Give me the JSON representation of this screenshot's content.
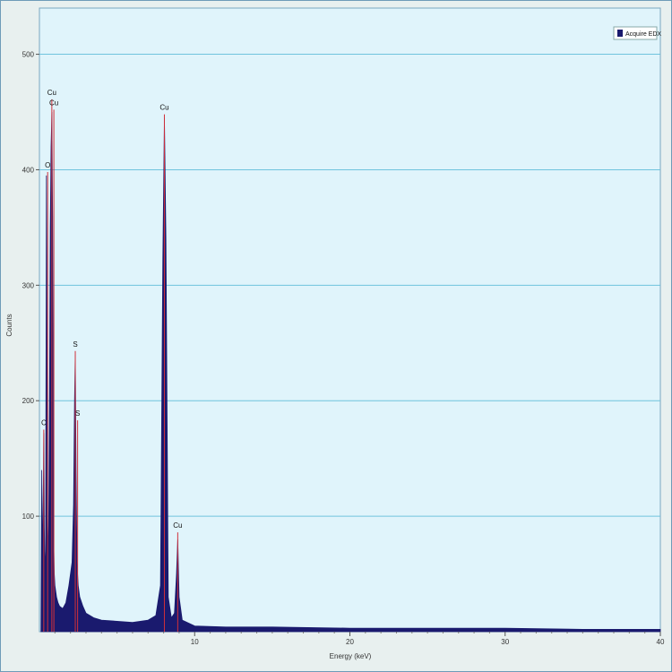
{
  "chart_data": {
    "type": "line",
    "xlabel": "Energy (keV)",
    "ylabel": "Counts",
    "xlim": [
      0,
      40
    ],
    "ylim": [
      0,
      500
    ],
    "xticks": [
      10,
      20,
      30,
      40
    ],
    "yticks": [
      100,
      200,
      300,
      400,
      500
    ],
    "grid": "horizontal",
    "legend": {
      "position": "top-right",
      "entries": [
        "Acquire EDX"
      ]
    },
    "series": [
      {
        "name": "Acquire EDX",
        "color": "#1a1a6e",
        "x": [
          0.1,
          0.15,
          0.2,
          0.25,
          0.28,
          0.32,
          0.36,
          0.4,
          0.45,
          0.5,
          0.52,
          0.55,
          0.6,
          0.65,
          0.7,
          0.75,
          0.8,
          0.85,
          0.9,
          0.93,
          0.96,
          1.0,
          1.05,
          1.1,
          1.2,
          1.3,
          1.5,
          1.7,
          1.9,
          2.1,
          2.2,
          2.26,
          2.31,
          2.36,
          2.42,
          2.5,
          2.6,
          2.8,
          3.0,
          3.5,
          4.0,
          5.0,
          6.0,
          7.0,
          7.5,
          7.8,
          7.95,
          8.05,
          8.15,
          8.3,
          8.5,
          8.7,
          8.83,
          8.91,
          9.0,
          9.2,
          10.0,
          12.0,
          15.0,
          20.0,
          25.0,
          30.0,
          35.0,
          40.0
        ],
        "y": [
          0,
          140,
          60,
          120,
          172,
          90,
          50,
          70,
          395,
          180,
          100,
          60,
          100,
          210,
          350,
          420,
          450,
          360,
          130,
          70,
          50,
          40,
          35,
          30,
          25,
          22,
          20,
          25,
          40,
          60,
          110,
          200,
          240,
          140,
          60,
          40,
          30,
          22,
          16,
          12,
          10,
          9,
          8,
          10,
          14,
          40,
          320,
          445,
          340,
          30,
          12,
          16,
          50,
          80,
          30,
          10,
          5,
          4,
          4,
          3,
          3,
          3,
          2,
          2
        ]
      }
    ],
    "annotations": [
      {
        "label": "C",
        "x": 0.28,
        "y": 175
      },
      {
        "label": "O",
        "x": 0.53,
        "y": 398
      },
      {
        "label": "Cu",
        "x": 0.8,
        "y": 461
      },
      {
        "label": "Cu",
        "x": 0.93,
        "y": 452
      },
      {
        "label": "S",
        "x": 2.31,
        "y": 243
      },
      {
        "label": "S",
        "x": 2.46,
        "y": 183
      },
      {
        "label": "Cu",
        "x": 8.05,
        "y": 448
      },
      {
        "label": "Cu",
        "x": 8.91,
        "y": 86
      }
    ]
  }
}
